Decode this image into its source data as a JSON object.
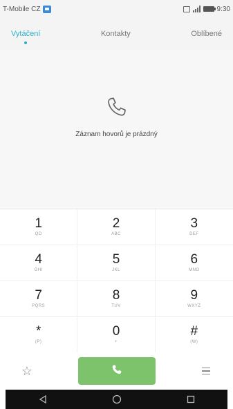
{
  "status_bar": {
    "carrier": "T-Mobile CZ",
    "time": "9:30"
  },
  "tabs": [
    {
      "label": "Vytáčení",
      "active": true
    },
    {
      "label": "Kontakty",
      "active": false
    },
    {
      "label": "Oblíbené",
      "active": false
    }
  ],
  "empty_state": {
    "icon": "phone-icon",
    "message": "Záznam hovorů je prázdný"
  },
  "dialpad": {
    "keys": [
      {
        "digit": "1",
        "letters": "QD"
      },
      {
        "digit": "2",
        "letters": "ABC"
      },
      {
        "digit": "3",
        "letters": "DEF"
      },
      {
        "digit": "4",
        "letters": "GHI"
      },
      {
        "digit": "5",
        "letters": "JKL"
      },
      {
        "digit": "6",
        "letters": "MNO"
      },
      {
        "digit": "7",
        "letters": "PQRS"
      },
      {
        "digit": "8",
        "letters": "TUV"
      },
      {
        "digit": "9",
        "letters": "WXYZ"
      },
      {
        "digit": "*",
        "letters": "(P)"
      },
      {
        "digit": "0",
        "letters": "+"
      },
      {
        "digit": "#",
        "letters": "(W)"
      }
    ]
  },
  "actions": {
    "favorite_icon": "star-outline-icon",
    "call_icon": "phone-icon",
    "menu_icon": "menu-icon"
  },
  "colors": {
    "accent": "#2cb0c8",
    "call_button": "#7cc36b"
  }
}
